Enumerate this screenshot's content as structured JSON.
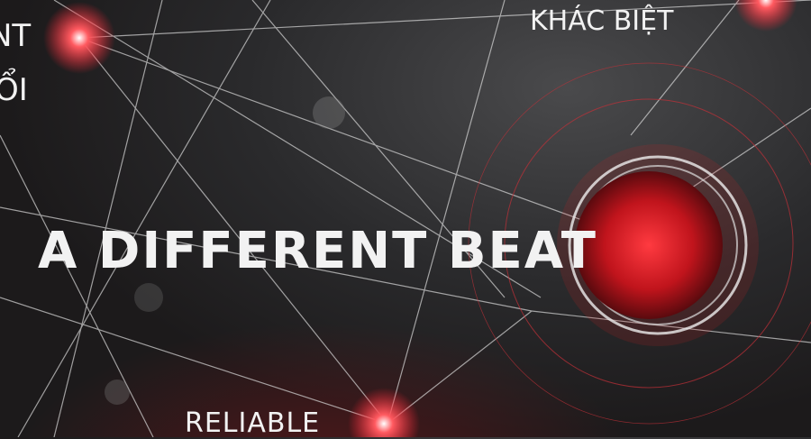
{
  "headline": "A DIFFERENT BEAT",
  "fragments": {
    "left_top": "NT",
    "left_bottom": "ỔI",
    "top_right": "KHÁC BIỆT",
    "bottom": "RELIABLE"
  },
  "colors": {
    "accent": "#d0202a",
    "background": "#232223",
    "text": "#f2f2f2"
  }
}
